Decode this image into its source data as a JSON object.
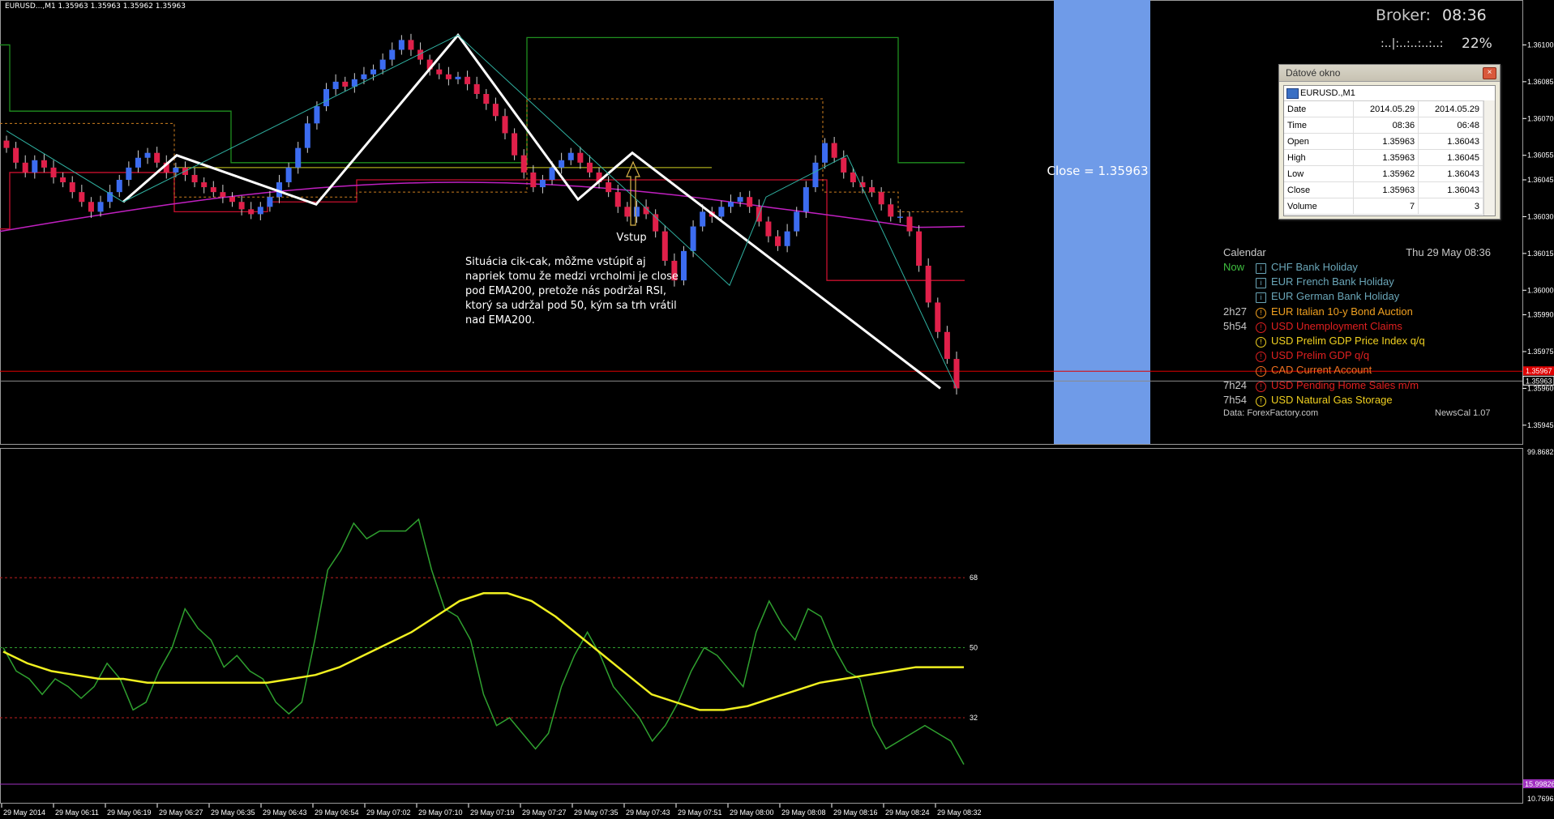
{
  "chart_header": "EURUSD...,M1  1.35963 1.35963 1.35962 1.35963",
  "broker": {
    "label": "Broker:",
    "time": "08:36"
  },
  "progress": {
    "bar": ":..|:..:..:..:..:",
    "percent": "22%"
  },
  "close_label": "Close = 1.35963",
  "annotation": {
    "entry_label": "Vstup",
    "lines": [
      "Situácia cik-cak, môžme vstúpiť aj",
      "napriek tomu že medzi vrcholmi je close",
      "pod EMA200, pretože nás podržal RSI,",
      "ktorý sa udržal pod 50, kým sa trh vrátil",
      "nad EMA200."
    ]
  },
  "data_window": {
    "title": "Dátové okno",
    "symbol": "EURUSD.,M1",
    "rows": [
      {
        "label": "Date",
        "v1": "2014.05.29",
        "v2": "2014.05.29"
      },
      {
        "label": "Time",
        "v1": "08:36",
        "v2": "06:48"
      },
      {
        "label": "Open",
        "v1": "1.35963",
        "v2": "1.36043"
      },
      {
        "label": "High",
        "v1": "1.35963",
        "v2": "1.36045"
      },
      {
        "label": "Low",
        "v1": "1.35962",
        "v2": "1.36043"
      },
      {
        "label": "Close",
        "v1": "1.35963",
        "v2": "1.36043"
      },
      {
        "label": "Volume",
        "v1": "7",
        "v2": "3"
      }
    ]
  },
  "calendar": {
    "title": "Calendar",
    "date": "Thu 29 May 08:36",
    "events": [
      {
        "time": "Now",
        "icon": "i",
        "text": "CHF  Bank Holiday",
        "color": "#6aa6b8",
        "time_color": "#3fbf3f"
      },
      {
        "time": "",
        "icon": "i",
        "text": "EUR  French Bank Holiday",
        "color": "#6aa6b8",
        "time_color": "#c8c8c8"
      },
      {
        "time": "",
        "icon": "i",
        "text": "EUR  German Bank Holiday",
        "color": "#6aa6b8",
        "time_color": "#c8c8c8"
      },
      {
        "time": "2h27",
        "icon": "!",
        "text": "EUR  Italian 10-y Bond Auction",
        "color": "#f0a020",
        "time_color": "#c8c8c8"
      },
      {
        "time": "5h54",
        "icon": "!",
        "text": "USD  Unemployment Claims",
        "color": "#e02020",
        "time_color": "#c8c8c8"
      },
      {
        "time": "",
        "icon": "!",
        "text": "USD  Prelim GDP Price Index q/q",
        "color": "#f0d020",
        "time_color": "#c8c8c8"
      },
      {
        "time": "",
        "icon": "!",
        "text": "USD  Prelim GDP q/q",
        "color": "#e02020",
        "time_color": "#c8c8c8"
      },
      {
        "time": "",
        "icon": "!",
        "text": "CAD  Current Account",
        "color": "#f07020",
        "time_color": "#c8c8c8"
      },
      {
        "time": "7h24",
        "icon": "!",
        "text": "USD  Pending Home Sales m/m",
        "color": "#e02020",
        "time_color": "#c8c8c8"
      },
      {
        "time": "7h54",
        "icon": "!",
        "text": "USD  Natural Gas Storage",
        "color": "#f0d020",
        "time_color": "#c8c8c8"
      }
    ],
    "footer_left": "Data: ForexFactory.com",
    "footer_right": "NewsCal 1.07"
  },
  "chart_data": [
    {
      "type": "candlestick",
      "symbol": "EURUSD",
      "timeframe": "M1",
      "ylim": [
        1.3594,
        1.36115
      ],
      "y_ticks": [
        "1.36100",
        "1.36085",
        "1.36070",
        "1.36055",
        "1.36045",
        "1.36030",
        "1.36015",
        "1.36000",
        "1.35990",
        "1.35975",
        "1.35960",
        "1.35945"
      ],
      "price_labels": [
        {
          "value": 1.35967,
          "text": "1.35967",
          "color": "#e00000"
        },
        {
          "value": 1.35963,
          "text": "1.35963",
          "color": "#ffffff"
        }
      ],
      "closes": [
        1.36058,
        1.36052,
        1.36048,
        1.36053,
        1.3605,
        1.36046,
        1.36044,
        1.3604,
        1.36036,
        1.36032,
        1.36036,
        1.3604,
        1.36045,
        1.3605,
        1.36054,
        1.36056,
        1.36052,
        1.36048,
        1.3605,
        1.36047,
        1.36044,
        1.36042,
        1.3604,
        1.36038,
        1.36036,
        1.36033,
        1.36031,
        1.36034,
        1.36038,
        1.36044,
        1.3605,
        1.36058,
        1.36068,
        1.36075,
        1.36082,
        1.36085,
        1.36083,
        1.36086,
        1.36088,
        1.3609,
        1.36094,
        1.36098,
        1.36102,
        1.36098,
        1.36094,
        1.3609,
        1.36088,
        1.36086,
        1.36087,
        1.36084,
        1.3608,
        1.36076,
        1.36071,
        1.36064,
        1.36055,
        1.36048,
        1.36042,
        1.36045,
        1.3605,
        1.36053,
        1.36056,
        1.36052,
        1.36048,
        1.36044,
        1.3604,
        1.36034,
        1.3603,
        1.36034,
        1.36031,
        1.36024,
        1.36012,
        1.36004,
        1.36016,
        1.36026,
        1.36032,
        1.3603,
        1.36034,
        1.36036,
        1.36038,
        1.36034,
        1.36028,
        1.36022,
        1.36018,
        1.36024,
        1.36032,
        1.36042,
        1.36052,
        1.3606,
        1.36054,
        1.36048,
        1.36044,
        1.36042,
        1.3604,
        1.36035,
        1.3603,
        1.3603,
        1.36024,
        1.3601,
        1.35995,
        1.35983,
        1.35972,
        1.3596
      ]
    },
    {
      "type": "line",
      "name": "RSI",
      "ylim": [
        10.7696,
        99.8682
      ],
      "y_ticks": [
        "99.8682",
        "10.7696"
      ],
      "levels": [
        {
          "value": 68,
          "text": "68",
          "color": "#c02020"
        },
        {
          "value": 50,
          "text": "50",
          "color": "#2fa02f"
        },
        {
          "value": 32,
          "text": "32",
          "color": "#c02020"
        }
      ],
      "current_label": "15.99826",
      "rsi": [
        50,
        44,
        42,
        38,
        42,
        40,
        37,
        40,
        46,
        42,
        34,
        36,
        44,
        50,
        60,
        55,
        52,
        45,
        48,
        44,
        42,
        36,
        33,
        36,
        52,
        70,
        75,
        82,
        78,
        80,
        80,
        80,
        83,
        70,
        60,
        58,
        52,
        38,
        30,
        32,
        28,
        24,
        28,
        40,
        48,
        54,
        48,
        40,
        36,
        32,
        26,
        30,
        36,
        44,
        50,
        48,
        44,
        40,
        54,
        62,
        56,
        52,
        60,
        58,
        50,
        44,
        42,
        30,
        24,
        26,
        28,
        30,
        28,
        26,
        20
      ],
      "signal": [
        49,
        46,
        44,
        43,
        42,
        42,
        41,
        41,
        41,
        41,
        41,
        41,
        42,
        43,
        45,
        48,
        51,
        54,
        58,
        62,
        64,
        64,
        62,
        58,
        53,
        48,
        43,
        38,
        36,
        34,
        34,
        35,
        37,
        39,
        41,
        42,
        43,
        44,
        45,
        45,
        45
      ]
    }
  ],
  "x_ticks": [
    "29 May 2014",
    "29 May 06:11",
    "29 May 06:19",
    "29 May 06:27",
    "29 May 06:35",
    "29 May 06:43",
    "29 May 06:54",
    "29 May 07:02",
    "29 May 07:10",
    "29 May 07:19",
    "29 May 07:27",
    "29 May 07:35",
    "29 May 07:43",
    "29 May 07:51",
    "29 May 08:00",
    "29 May 08:08",
    "29 May 08:16",
    "29 May 08:24",
    "29 May 08:32"
  ],
  "colors": {
    "bull": "#3c6cf0",
    "bear": "#e0204a",
    "ema200": "#c020c0",
    "zigzag": "#ffffff",
    "green_line": "#1f8f1f",
    "rsi": "#2fa02f",
    "rsi_signal": "#f0f020",
    "close_panel": "#6f9be8"
  }
}
